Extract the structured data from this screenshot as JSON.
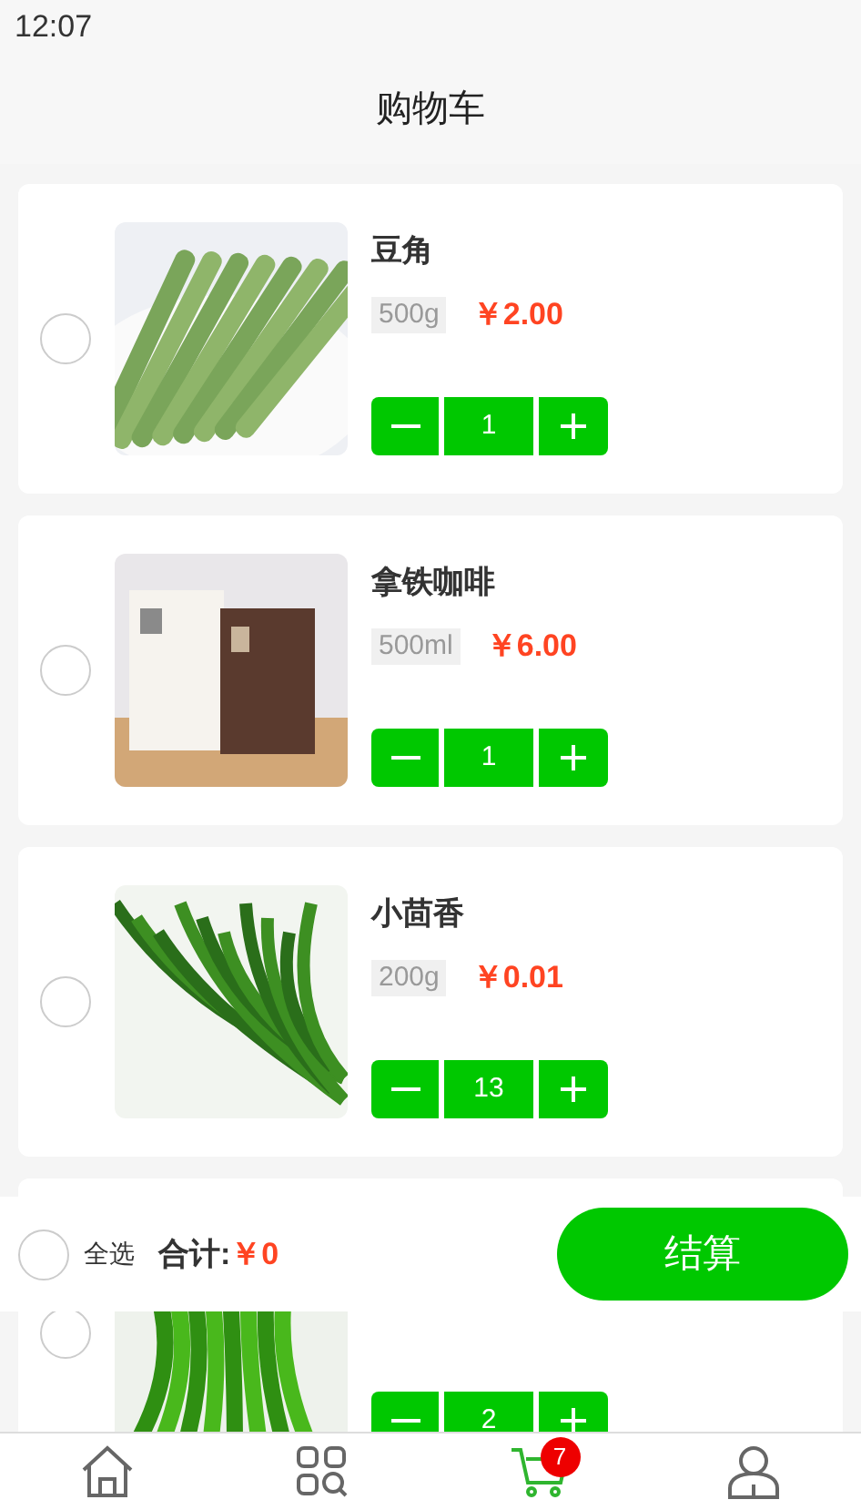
{
  "status_bar": {
    "time": "12:07"
  },
  "header": {
    "title": "购物车"
  },
  "items": [
    {
      "name": "豆角",
      "spec": "500g",
      "price": "￥2.00",
      "quantity": "1",
      "selected": false,
      "kind": "beans"
    },
    {
      "name": "拿铁咖啡",
      "spec": "500ml",
      "price": "￥6.00",
      "quantity": "1",
      "selected": false,
      "kind": "boxes"
    },
    {
      "name": "小茴香",
      "spec": "200g",
      "price": "￥0.01",
      "quantity": "13",
      "selected": false,
      "kind": "herb"
    },
    {
      "quantity": "2",
      "selected": false,
      "kind": "greens"
    }
  ],
  "checkout_bar": {
    "select_all": {
      "label": "全选",
      "selected": false
    },
    "total_label": "合计:",
    "total": "￥0",
    "button": "结算"
  },
  "tab_bar": [
    {
      "kind": "home",
      "selected": false
    },
    {
      "kind": "categories",
      "selected": false
    },
    {
      "kind": "cart",
      "selected": true,
      "badge": "7"
    },
    {
      "kind": "user",
      "selected": false
    }
  ]
}
